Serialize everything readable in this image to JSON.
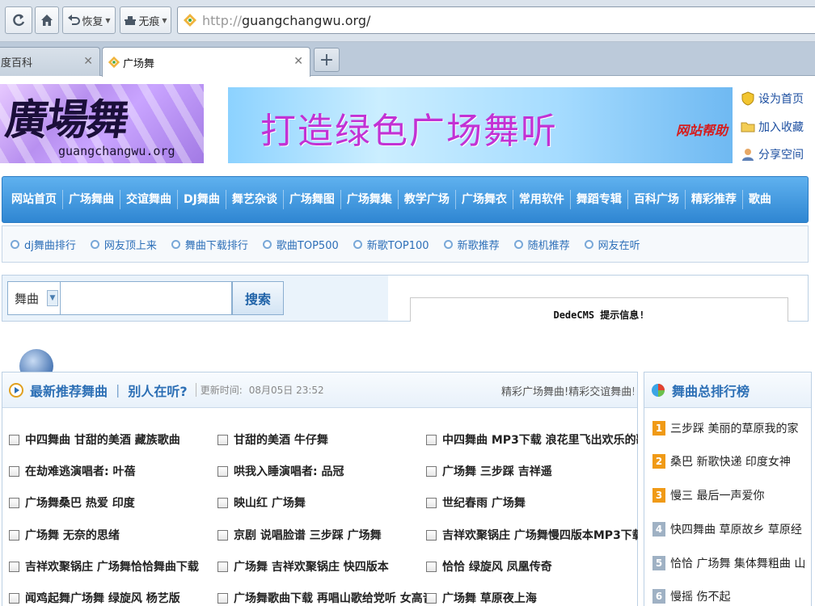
{
  "browser": {
    "back_label": "恢复",
    "trace_label": "无痕",
    "url_protocol": "http://",
    "url_host": "guangchangwu.org/",
    "tabs": [
      {
        "label": "度百科"
      },
      {
        "label": "广场舞"
      }
    ]
  },
  "header": {
    "logo_text": "廣場舞",
    "logo_domain": "guangchangwu.org",
    "banner_slogan": "打造绿色广场舞听",
    "banner_help": "网站帮助",
    "quick_links": [
      "设为首页",
      "加入收藏",
      "分享空间"
    ]
  },
  "nav": {
    "items": [
      "网站首页",
      "广场舞曲",
      "交谊舞曲",
      "DJ舞曲",
      "舞艺杂谈",
      "广场舞图",
      "广场舞集",
      "教学广场",
      "广场舞衣",
      "常用软件",
      "舞蹈专辑",
      "百科广场",
      "精彩推荐",
      "歌曲"
    ]
  },
  "subnav": {
    "items": [
      "dj舞曲排行",
      "网友顶上来",
      "舞曲下载排行",
      "歌曲TOP500",
      "新歌TOP100",
      "新歌推荐",
      "随机推荐",
      "网友在听"
    ]
  },
  "search": {
    "category": "舞曲",
    "button": "搜索",
    "notice": "DedeCMS 提示信息!"
  },
  "main": {
    "title_latest": "最新推荐舞曲",
    "separator": "|",
    "title_listening": "别人在听?",
    "updated_label": "更新时间:",
    "updated_time": "08月05日 23:52",
    "marquee": "精彩广场舞曲!精彩交谊舞曲!",
    "rows": [
      [
        "中四舞曲 甘甜的美酒 藏族歌曲",
        "甘甜的美酒 牛仔舞",
        "中四舞曲 MP3下载 浪花里飞出欢乐的歌"
      ],
      [
        "在劫难逃演唱者: 叶蓓",
        "哄我入睡演唱者: 品冠",
        "广场舞 三步踩 吉祥遥"
      ],
      [
        "广场舞桑巴 热爱 印度",
        "映山红 广场舞",
        "世纪春雨 广场舞"
      ],
      [
        "广场舞 无奈的思绪",
        "京剧 说唱脸谱 三步踩 广场舞",
        "吉祥欢聚锅庄 广场舞慢四版本MP3下载"
      ],
      [
        "吉祥欢聚锅庄 广场舞恰恰舞曲下载",
        "广场舞 吉祥欢聚锅庄 快四版本",
        "恰恰 绿旋风 凤凰传奇"
      ],
      [
        "闻鸡起舞广场舞 绿旋风 杨艺版",
        "广场舞歌曲下载 再唱山歌给党听 女高音",
        "广场舞 草原夜上海"
      ]
    ]
  },
  "ranking": {
    "title": "舞曲总排行榜",
    "items": [
      {
        "rank": "1",
        "text": "三步踩 美丽的草原我的家"
      },
      {
        "rank": "2",
        "text": "桑巴 新歌快递 印度女神"
      },
      {
        "rank": "3",
        "text": "慢三 最后一声爱你"
      },
      {
        "rank": "4",
        "text": "快四舞曲 草原故乡 草原经"
      },
      {
        "rank": "5",
        "text": "恰恰 广场舞 集体舞粗曲 山"
      },
      {
        "rank": "6",
        "text": "慢摇 伤不起"
      }
    ]
  }
}
